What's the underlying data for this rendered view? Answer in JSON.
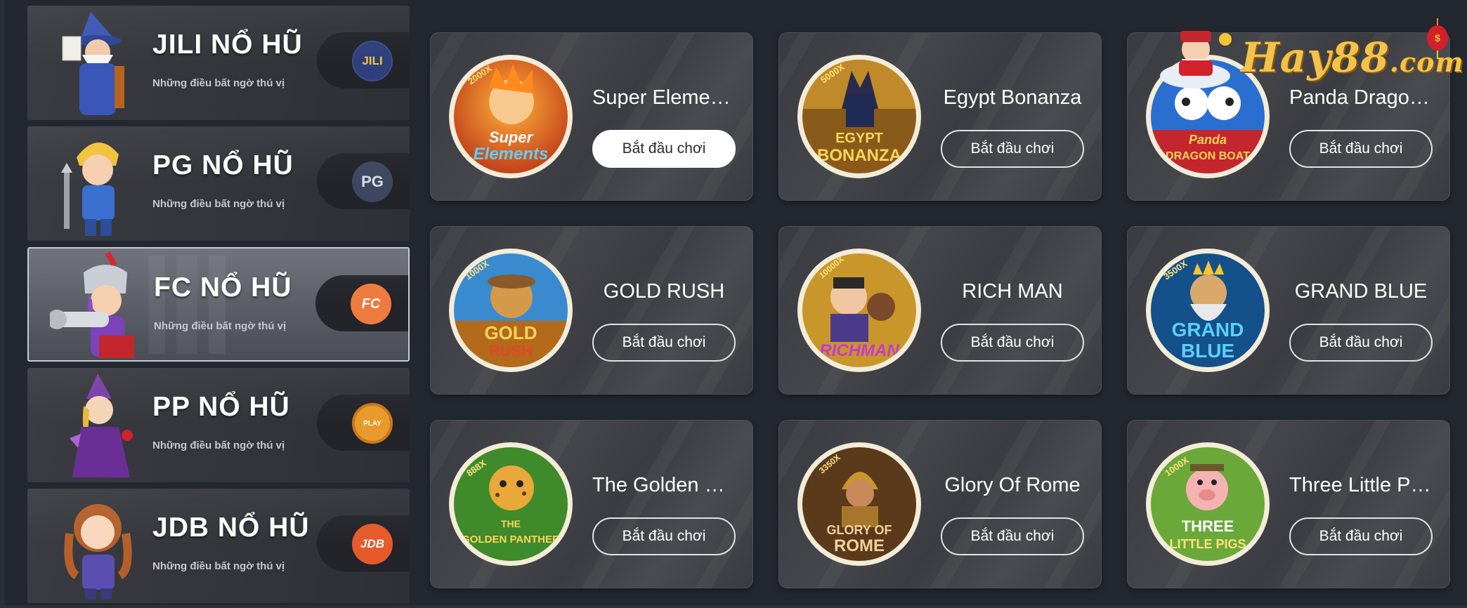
{
  "providers": [
    {
      "title": "JILI NỔ HŨ",
      "subtitle": "Những điều bất ngờ thú vị",
      "badge": "JILI"
    },
    {
      "title": "PG NỔ HŨ",
      "subtitle": "Những điều bất ngờ thú vị",
      "badge": "PG"
    },
    {
      "title": "FC NỔ HŨ",
      "subtitle": "Những điều bất ngờ thú vị",
      "badge": "FC"
    },
    {
      "title": "PP NỔ HŨ",
      "subtitle": "Những điều bất ngờ thú vị",
      "badge": "PLAY"
    },
    {
      "title": "JDB NỔ HŨ",
      "subtitle": "Những điều bất ngờ thú vị",
      "badge": "JDB"
    }
  ],
  "active_provider": "FC NỔ HŨ",
  "games": [
    {
      "name": "Super Elements",
      "thumb_mult": "2000X",
      "thumb_line1": "Super",
      "thumb_line2": "Elements",
      "button": "Bắt đầu chơi"
    },
    {
      "name": "Egypt Bonanza",
      "thumb_mult": "5000X",
      "thumb_line1": "EGYPT",
      "thumb_line2": "BONANZA",
      "button": "Bắt đầu chơi"
    },
    {
      "name": "Panda Dragon Boat",
      "thumb_mult": "",
      "thumb_line1": "Panda",
      "thumb_line2": "DRAGON BOAT",
      "button": "Bắt đầu chơi"
    },
    {
      "name": "GOLD RUSH",
      "thumb_mult": "1000X",
      "thumb_line1": "GOLD",
      "thumb_line2": "RUSH",
      "button": "Bắt đầu chơi"
    },
    {
      "name": "RICH MAN",
      "thumb_mult": "10000X",
      "thumb_line1": "",
      "thumb_line2": "RICHMAN",
      "button": "Bắt đầu chơi"
    },
    {
      "name": "GRAND BLUE",
      "thumb_mult": "3500X",
      "thumb_line1": "GRAND",
      "thumb_line2": "BLUE",
      "button": "Bắt đầu chơi"
    },
    {
      "name": "The Golden Panther",
      "thumb_mult": "888X",
      "thumb_line1": "THE",
      "thumb_line2": "GOLDEN PANTHER",
      "button": "Bắt đầu chơi"
    },
    {
      "name": "Glory Of Rome",
      "thumb_mult": "3350X",
      "thumb_line1": "GLORY OF",
      "thumb_line2": "ROME",
      "button": "Bắt đầu chơi"
    },
    {
      "name": "Three Little Pigs",
      "thumb_mult": "1000X",
      "thumb_line1": "THREE",
      "thumb_line2": "LITTLE PIGS",
      "button": "Bắt đầu chơi"
    }
  ],
  "logo": {
    "text": "Hay88",
    "suffix": ".com"
  },
  "colors": {
    "background": "#23272f",
    "card": "#3f4045",
    "button_border": "#e2e3e6",
    "logo_gold": "#f2c24c",
    "thumb_ring": "#f3ecd8"
  }
}
